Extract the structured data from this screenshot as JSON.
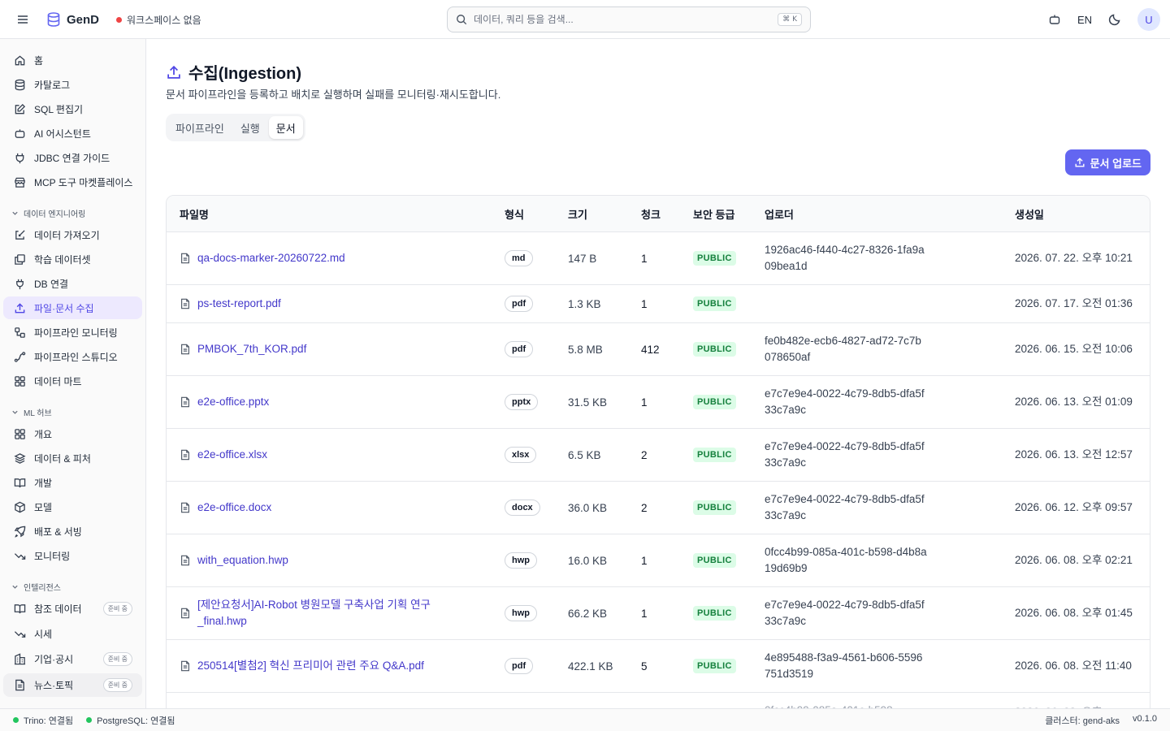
{
  "topbar": {
    "brand": "GenD",
    "workspace": "워크스페이스 없음",
    "search_placeholder": "데이터, 쿼리 등을 검색...",
    "shortcut": "⌘ K",
    "lang": "EN",
    "avatar": "U"
  },
  "sidebar": {
    "items": [
      {
        "label": "홈",
        "icon": "home-icon"
      },
      {
        "label": "카탈로그",
        "icon": "database-icon"
      },
      {
        "label": "SQL 편집기",
        "icon": "edit-icon"
      },
      {
        "label": "AI 어시스턴트",
        "icon": "bot-icon"
      },
      {
        "label": "JDBC 연결 가이드",
        "icon": "plug-icon"
      },
      {
        "label": "MCP 도구 마켓플레이스",
        "icon": "store-icon"
      }
    ],
    "section_engineering": "데이터 엔지니어링",
    "engineering_items": [
      {
        "label": "데이터 가져오기",
        "icon": "import-icon"
      },
      {
        "label": "학습 데이터셋",
        "icon": "dataset-icon"
      },
      {
        "label": "DB 연결",
        "icon": "plug-icon"
      },
      {
        "label": "파일·문서 수집",
        "icon": "upload-icon"
      },
      {
        "label": "파이프라인 모니터링",
        "icon": "workflow-icon"
      },
      {
        "label": "파이프라인 스튜디오",
        "icon": "spline-icon"
      },
      {
        "label": "데이터 마트",
        "icon": "grid-icon"
      }
    ],
    "section_ml": "ML 허브",
    "ml_items": [
      {
        "label": "개요",
        "icon": "grid-icon"
      },
      {
        "label": "데이터 & 피처",
        "icon": "layers-icon"
      },
      {
        "label": "개발",
        "icon": "book-icon"
      },
      {
        "label": "모델",
        "icon": "box-icon"
      },
      {
        "label": "배포 & 서빙",
        "icon": "rocket-icon"
      },
      {
        "label": "모니터링",
        "icon": "trend-icon"
      }
    ],
    "section_intel": "인텔리전스",
    "intel_items": [
      {
        "label": "참조 데이터",
        "icon": "book-icon",
        "badge": "준비 중"
      },
      {
        "label": "시세",
        "icon": "trend-icon",
        "badge": ""
      },
      {
        "label": "기업·공시",
        "icon": "building-icon",
        "badge": "준비 중"
      },
      {
        "label": "뉴스·토픽",
        "icon": "news-icon",
        "badge": "준비 중"
      }
    ]
  },
  "page": {
    "title": "수집(Ingestion)",
    "description": "문서 파이프라인을 등록하고 배치로 실행하며 실패를 모니터링·재시도합니다.",
    "tabs": [
      "파이프라인",
      "실행",
      "문서"
    ],
    "active_tab": "문서",
    "upload_label": "문서 업로드"
  },
  "table": {
    "headers": [
      "파일명",
      "형식",
      "크기",
      "청크",
      "보안 등급",
      "업로더",
      "생성일"
    ],
    "rows": [
      {
        "name": "qa-docs-marker-20260722.md",
        "fmt": "md",
        "size": "147 B",
        "chunks": "1",
        "sec": "PUBLIC",
        "uploader": "1926ac46-f440-4c27-8326-1fa9a09bea1d",
        "created": "2026. 07. 22. 오후 10:21"
      },
      {
        "name": "ps-test-report.pdf",
        "fmt": "pdf",
        "size": "1.3 KB",
        "chunks": "1",
        "sec": "PUBLIC",
        "uploader": "",
        "created": "2026. 07. 17. 오전 01:36"
      },
      {
        "name": "PMBOK_7th_KOR.pdf",
        "fmt": "pdf",
        "size": "5.8 MB",
        "chunks": "412",
        "sec": "PUBLIC",
        "uploader": "fe0b482e-ecb6-4827-ad72-7c7b078650af",
        "created": "2026. 06. 15. 오전 10:06"
      },
      {
        "name": "e2e-office.pptx",
        "fmt": "pptx",
        "size": "31.5 KB",
        "chunks": "1",
        "sec": "PUBLIC",
        "uploader": "e7c7e9e4-0022-4c79-8db5-dfa5f33c7a9c",
        "created": "2026. 06. 13. 오전 01:09"
      },
      {
        "name": "e2e-office.xlsx",
        "fmt": "xlsx",
        "size": "6.5 KB",
        "chunks": "2",
        "sec": "PUBLIC",
        "uploader": "e7c7e9e4-0022-4c79-8db5-dfa5f33c7a9c",
        "created": "2026. 06. 13. 오전 12:57"
      },
      {
        "name": "e2e-office.docx",
        "fmt": "docx",
        "size": "36.0 KB",
        "chunks": "2",
        "sec": "PUBLIC",
        "uploader": "e7c7e9e4-0022-4c79-8db5-dfa5f33c7a9c",
        "created": "2026. 06. 12. 오후 09:57"
      },
      {
        "name": "with_equation.hwp",
        "fmt": "hwp",
        "size": "16.0 KB",
        "chunks": "1",
        "sec": "PUBLIC",
        "uploader": "0fcc4b99-085a-401c-b598-d4b8a19d69b9",
        "created": "2026. 06. 08. 오후 02:21"
      },
      {
        "name": "[제안요청서]AI-Robot 병원모델 구축사업 기획 연구_final.hwp",
        "fmt": "hwp",
        "size": "66.2 KB",
        "chunks": "1",
        "sec": "PUBLIC",
        "uploader": "e7c7e9e4-0022-4c79-8db5-dfa5f33c7a9c",
        "created": "2026. 06. 08. 오후 01:45"
      },
      {
        "name": "250514[별첨2] 혁신 프리미어 관련 주요 Q&A.pdf",
        "fmt": "pdf",
        "size": "422.1 KB",
        "chunks": "5",
        "sec": "PUBLIC",
        "uploader": "4e895488-f3a9-4561-b606-5596751d3519",
        "created": "2026. 06. 08. 오전 11:40"
      }
    ]
  },
  "statusbar": {
    "trino": "Trino: 연결됨",
    "postgres": "PostgreSQL: 연결됨",
    "cluster": "클러스터: gend-aks",
    "version": "v0.1.0"
  },
  "colors": {
    "accent": "#6366f1",
    "link": "#4338ca",
    "public_bg": "#dcfce7",
    "public_fg": "#15803d",
    "status_ok": "#22c55e",
    "workspace_dot": "#ef4444"
  }
}
